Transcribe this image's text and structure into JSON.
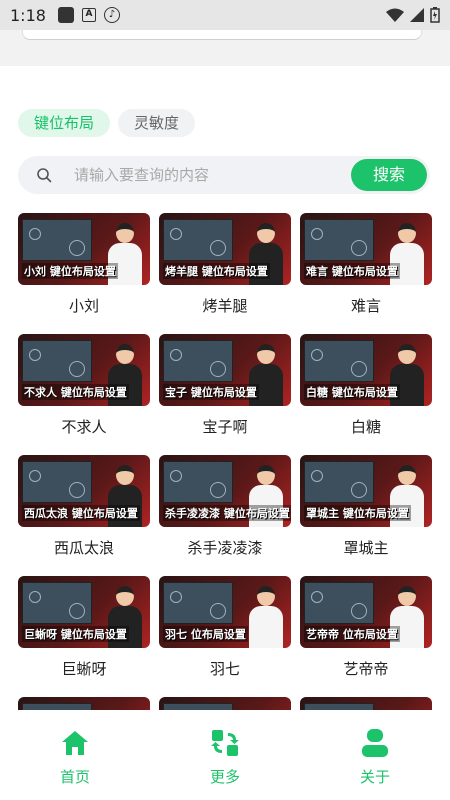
{
  "status_bar": {
    "time": "1:18"
  },
  "tabs": [
    {
      "label": "键位布局",
      "active": true
    },
    {
      "label": "灵敏度",
      "active": false
    }
  ],
  "search": {
    "placeholder": "请输入要查询的内容",
    "button_label": "搜索"
  },
  "grid": {
    "items": [
      {
        "name": "小刘",
        "banner_title": "小刘 键位布局设置"
      },
      {
        "name": "烤羊腿",
        "banner_title": "烤羊腿 键位布局设置"
      },
      {
        "name": "难言",
        "banner_title": "难言 键位布局设置"
      },
      {
        "name": "不求人",
        "banner_title": "不求人 键位布局设置"
      },
      {
        "name": "宝子啊",
        "banner_title": "宝子 键位布局设置"
      },
      {
        "name": "白糖",
        "banner_title": "白糖 键位布局设置"
      },
      {
        "name": "西瓜太浪",
        "banner_title": "西瓜太浪 键位布局设置"
      },
      {
        "name": "杀手凌凌漆",
        "banner_title": "杀手凌凌漆 键位布局设置"
      },
      {
        "name": "罩城主",
        "banner_title": "罩城主 键位布局设置"
      },
      {
        "name": "巨蜥呀",
        "banner_title": "巨蜥呀 键位布局设置"
      },
      {
        "name": "羽七",
        "banner_title": "羽七 位布局设置"
      },
      {
        "name": "艺帝帝",
        "banner_title": "艺帝帝 位布局设置"
      },
      {
        "name": "",
        "banner_title": ""
      },
      {
        "name": "",
        "banner_title": ""
      },
      {
        "name": "",
        "banner_title": ""
      }
    ]
  },
  "bottom_nav": [
    {
      "label": "首页",
      "icon": "home-icon"
    },
    {
      "label": "更多",
      "icon": "refresh-icon"
    },
    {
      "label": "关于",
      "icon": "user-icon"
    }
  ],
  "colors": {
    "accent": "#1dc36a",
    "tab_active_bg": "#e1f7ea"
  }
}
